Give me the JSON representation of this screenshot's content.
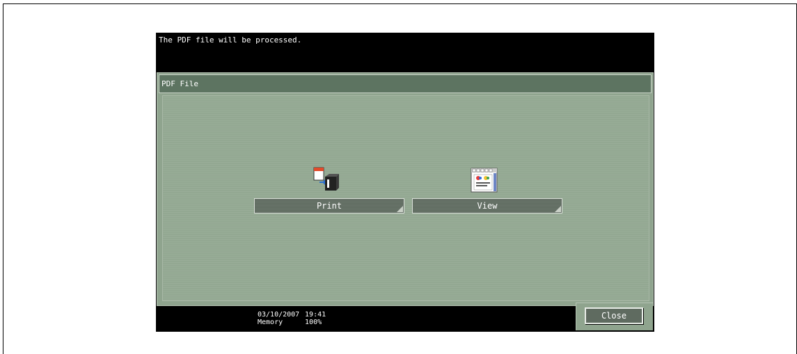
{
  "message": "The PDF file will be processed.",
  "dialog": {
    "title": "PDF File",
    "options": [
      {
        "label": "Print",
        "icon": "print-icon"
      },
      {
        "label": "View",
        "icon": "view-icon"
      }
    ],
    "close_label": "Close"
  },
  "status": {
    "date": "03/10/2007",
    "time": "19:41",
    "memory_label": "Memory",
    "memory_value": "100%"
  },
  "colors": {
    "panel_bg": "#000000",
    "dialog_bg": "#8fa48e",
    "title_bar": "#5d7461",
    "button_bg": "#5f6b60"
  }
}
